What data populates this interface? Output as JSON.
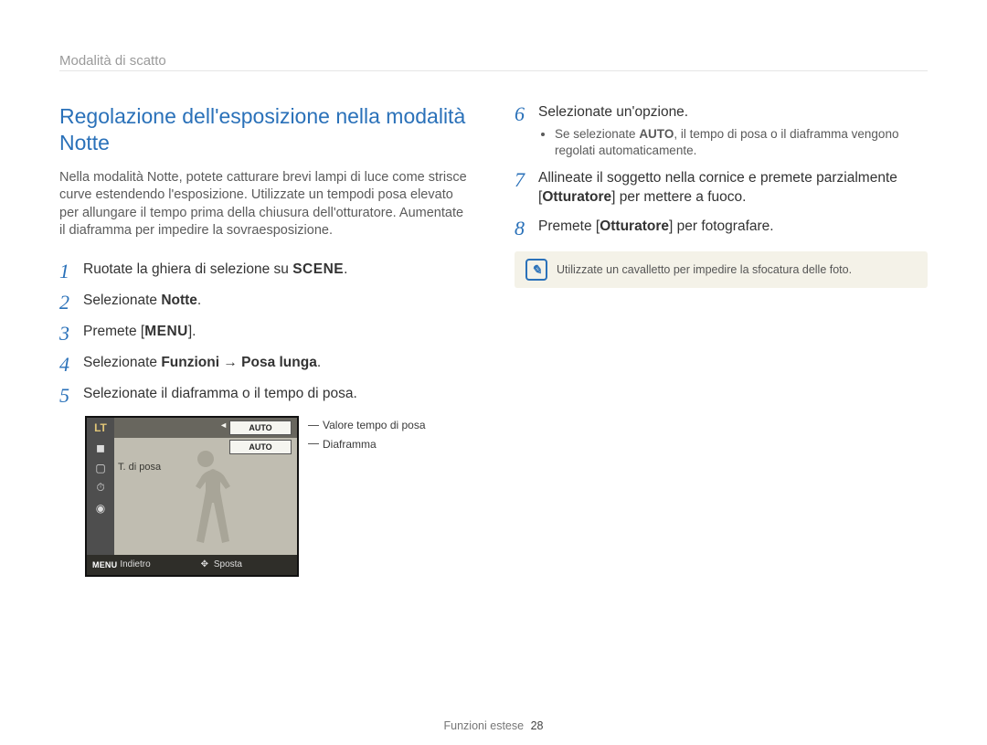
{
  "breadcrumb": "Modalità di scatto",
  "title": "Regolazione dell'esposizione nella modalità Notte",
  "intro": "Nella modalità Notte, potete catturare brevi lampi di luce come strisce curve estendendo l'esposizione. Utilizzate un tempodi posa elevato per allungare il tempo prima della chiusura dell'otturatore. Aumentate il diaframma per impedire la sovraesposizione.",
  "steps_left": {
    "s1_a": "Ruotate la ghiera di selezione su ",
    "s1_scene": "SCENE",
    "s1_b": ".",
    "s2_a": "Selezionate ",
    "s2_b": "Notte",
    "s2_c": ".",
    "s3_a": "Premete [",
    "s3_b": "MENU",
    "s3_c": "].",
    "s4_a": "Selezionate ",
    "s4_b": "Funzioni",
    "s4_arrow": " → ",
    "s4_c": "Posa lunga",
    "s4_d": ".",
    "s5": "Selezionate il diaframma o il tempo di posa."
  },
  "lcd": {
    "lt": "LT",
    "auto1": "AUTO",
    "auto2": "AUTO",
    "label": "T. di posa",
    "back_key": "MENU",
    "back_text": "Indietro",
    "move_text": "Sposta",
    "icons": [
      "◼",
      "▢",
      "⏱",
      "◉"
    ]
  },
  "callouts": {
    "c1": "Valore tempo di posa",
    "c2": "Diaframma"
  },
  "steps_right": {
    "s6": "Selezionate un'opzione.",
    "s6_sub_a": "Se selezionate ",
    "s6_sub_b": "AUTO",
    "s6_sub_c": ", il tempo di posa o il diaframma vengono regolati automaticamente.",
    "s7_a": "Allineate il soggetto nella cornice e premete parzialmente [",
    "s7_b": "Otturatore",
    "s7_c": "] per mettere a fuoco.",
    "s8_a": "Premete [",
    "s8_b": "Otturatore",
    "s8_c": "] per fotografare."
  },
  "note": "Utilizzate un cavalletto per impedire la sfocatura delle foto.",
  "footer_label": "Funzioni estese",
  "footer_page": "28"
}
